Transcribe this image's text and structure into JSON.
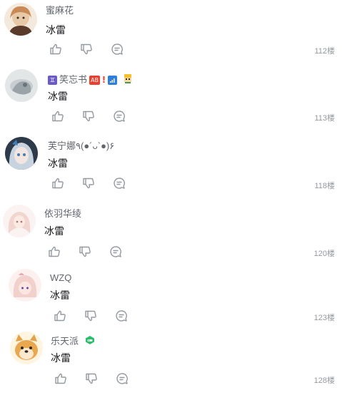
{
  "comments": [
    {
      "username": "蜜麻花",
      "content": "冰雷",
      "floor": "112楼"
    },
    {
      "username": "笑忘书",
      "content": "冰雷",
      "floor": "113楼",
      "badges": {
        "zodiac": "♊",
        "ab": "AB",
        "exclaim": "!"
      }
    },
    {
      "username": "芙宁娜٩(●´ᴗ`●)۶",
      "content": "冰雷",
      "floor": "118楼"
    },
    {
      "username": "依羽华绫",
      "content": "冰雷",
      "floor": "120楼"
    },
    {
      "username": "WZQ",
      "content": "冰雷",
      "floor": "123楼"
    },
    {
      "username": "乐天派",
      "content": "冰雷",
      "floor": "128楼"
    }
  ],
  "icons": {
    "like": "thumbs-up-icon",
    "dislike": "thumbs-down-icon",
    "reply": "reply-bubble-icon"
  },
  "colors": {
    "username": "#61666d",
    "content": "#18191c",
    "floor": "#9499a0",
    "icon": "#9499a0"
  }
}
